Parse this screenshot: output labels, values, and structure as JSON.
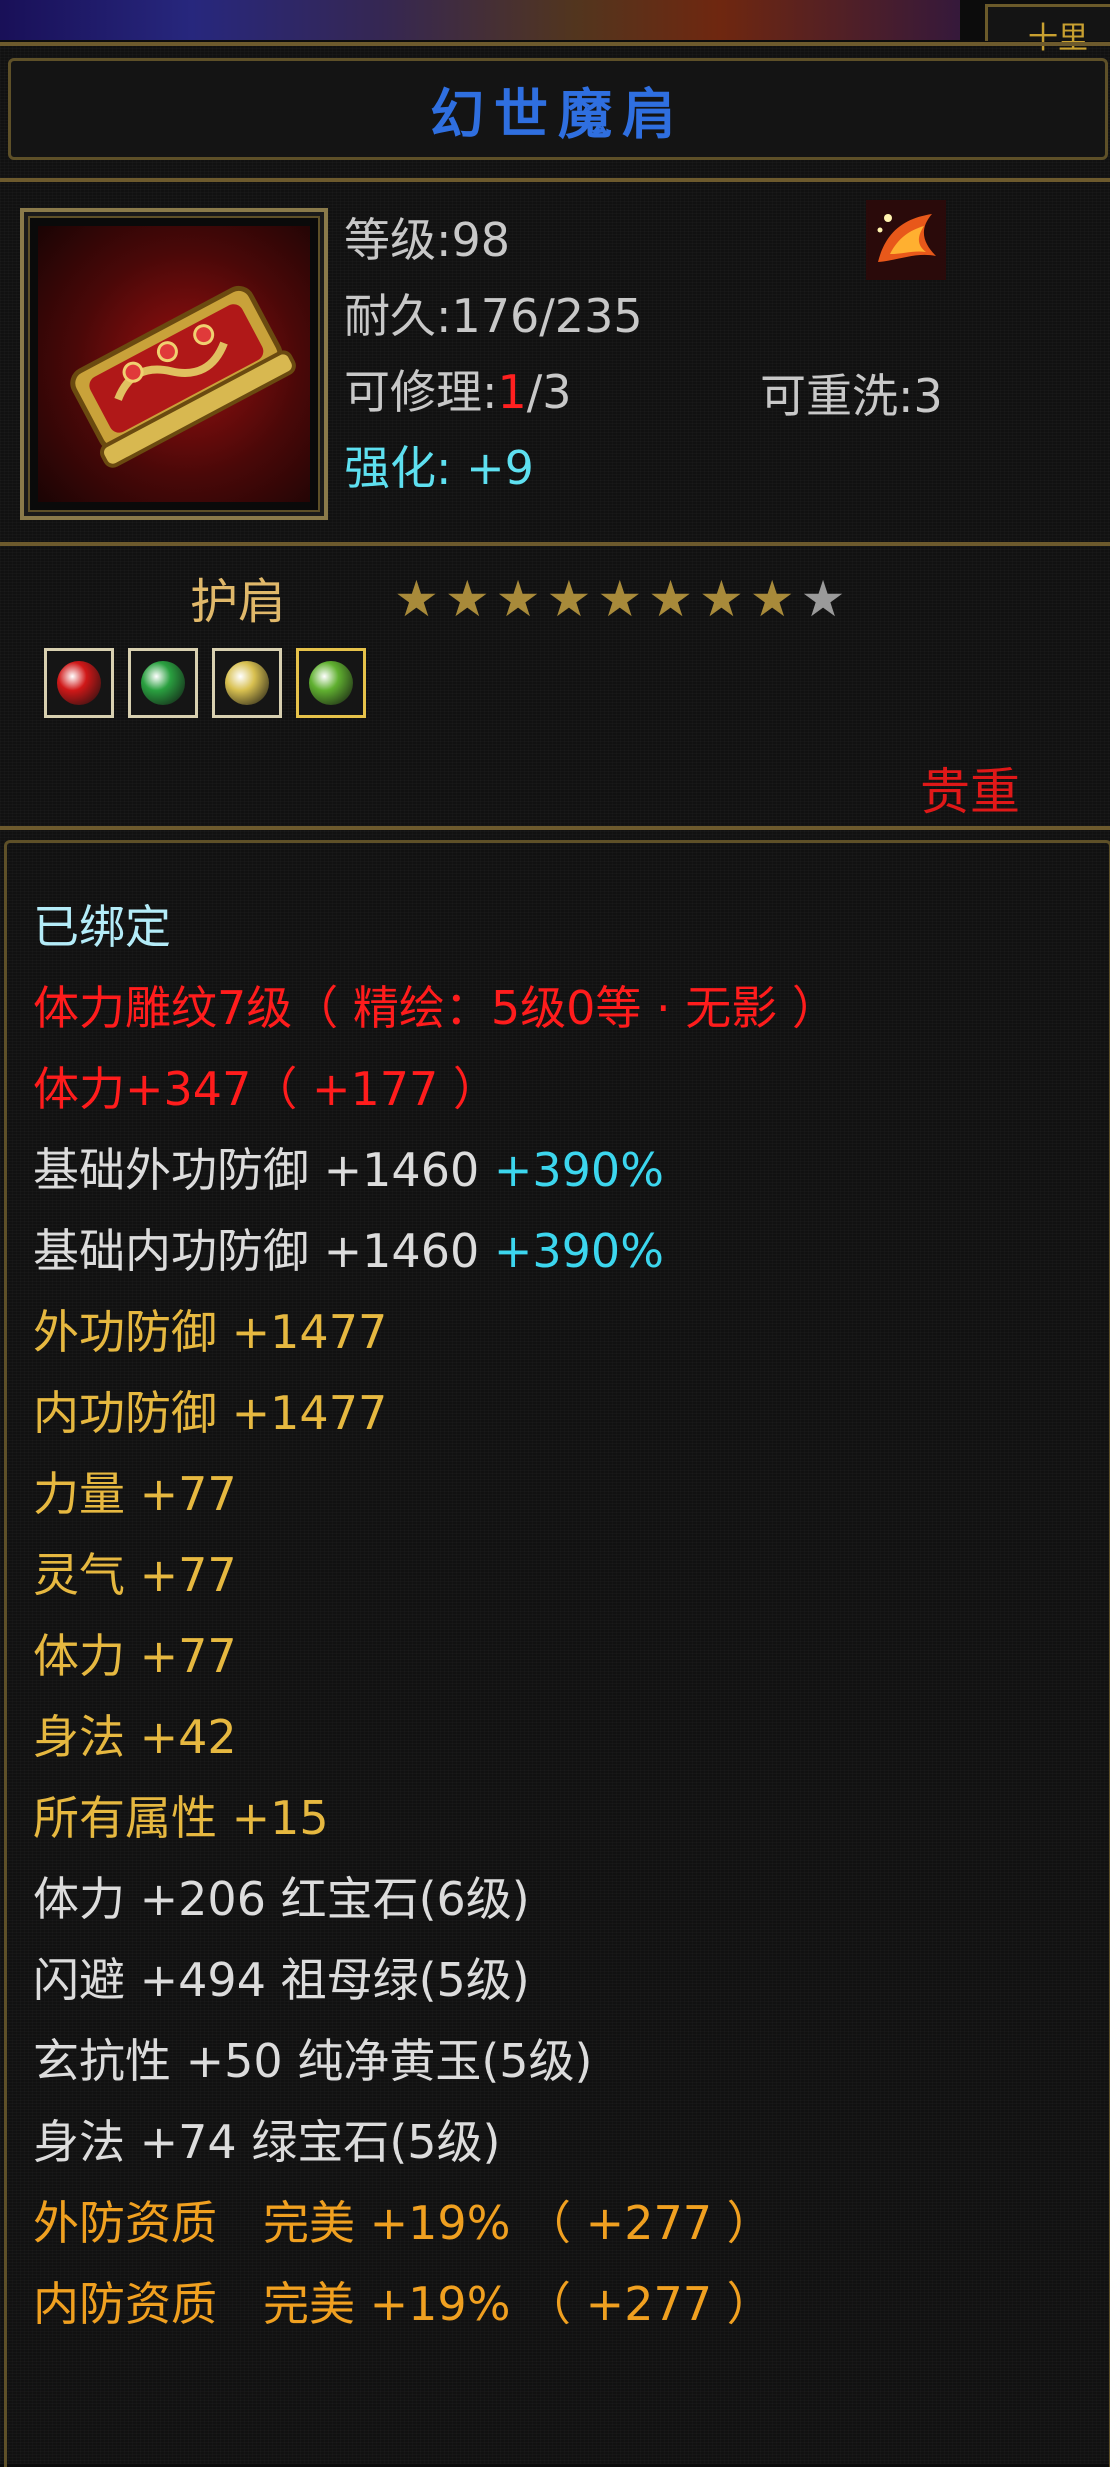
{
  "banner": {
    "right_text": "十里"
  },
  "title": "幻世魔肩",
  "item": {
    "level": "等级:98",
    "durability": "耐久:176/235",
    "repair_prefix": "可修理:",
    "repair_current": "1",
    "repair_total": "/3",
    "rewash": "可重洗:3",
    "enhance": "强化: +9",
    "icon": "golden-pauldron-icon"
  },
  "slot": {
    "label": "护肩",
    "stars_filled": 8,
    "stars_total": 9,
    "gems": [
      {
        "icon": "red-gem-icon",
        "color": "#d01818"
      },
      {
        "icon": "green-gem-icon",
        "color": "#2aa040"
      },
      {
        "icon": "yellow-gem-icon",
        "color": "#d8c050"
      },
      {
        "icon": "emerald-gem-icon",
        "color": "#60b030"
      }
    ],
    "quality": "贵重"
  },
  "attributes": {
    "bound": "已绑定",
    "engrave": "体力雕纹7级（ 精绘：5级0等 · 无影 ）",
    "stamina_main": "体力+347（ +177 ）",
    "base_ext_def": "基础外功防御 +1460",
    "base_ext_def_pct": "+390%",
    "base_int_def": "基础内功防御 +1460",
    "base_int_def_pct": "+390%",
    "ext_def": "外功防御 +1477",
    "int_def": "内功防御 +1477",
    "strength": "力量 +77",
    "spirit": "灵气 +77",
    "stamina": "体力 +77",
    "agility": "身法 +42",
    "all_attr": "所有属性 +15",
    "gem_stamina": "体力 +206 红宝石(6级)",
    "gem_dodge": "闪避 +494 祖母绿(5级)",
    "gem_resist": "玄抗性 +50 纯净黄玉(5级)",
    "gem_agility": "身法 +74 绿宝石(5级)",
    "ext_quality": "外防资质　完美 +19% （ +277 ）",
    "int_quality": "内防资质　完美 +19% （ +277 ）"
  },
  "colors": {
    "title": "#2f6fe0",
    "red": "#ff1c1c",
    "cyan": "#3cd6ee",
    "yellow": "#e6b840",
    "orange": "#f0a020"
  }
}
